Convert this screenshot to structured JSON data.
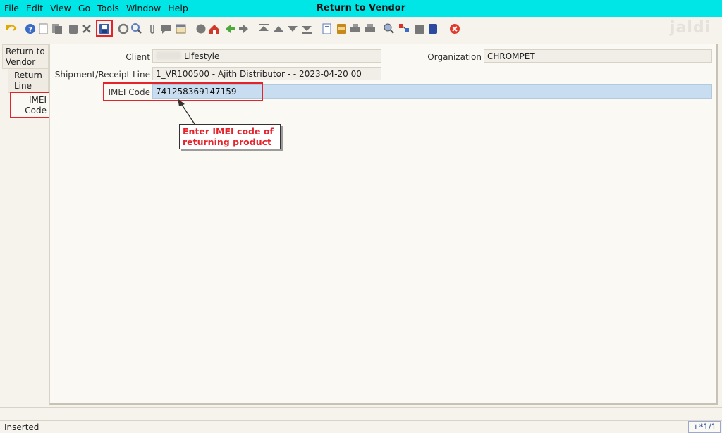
{
  "menu": {
    "items": [
      "File",
      "Edit",
      "View",
      "Go",
      "Tools",
      "Window",
      "Help"
    ]
  },
  "window": {
    "title": "Return to Vendor"
  },
  "watermark": {
    "text": "jaldi"
  },
  "toolbar": {
    "icons": [
      "undo-icon",
      "help-icon",
      "new-icon",
      "copy-icon",
      "delete-icon",
      "delete-selection-icon",
      "save-icon",
      "refresh-icon",
      "find-icon",
      "attachment-icon",
      "chat-icon",
      "grid-toggle-icon",
      "history-icon",
      "home-icon",
      "back-icon",
      "forward-icon",
      "first-record-icon",
      "previous-record-icon",
      "next-record-icon",
      "last-record-icon",
      "report-icon",
      "archive-icon",
      "print-icon",
      "print-preview-icon",
      "zoom-across-icon",
      "request-icon",
      "product-info-icon",
      "workflow-icon",
      "end-icon"
    ]
  },
  "tabs": [
    {
      "label": "Return to Vendor"
    },
    {
      "label": "Return Line"
    },
    {
      "label": "IMEI Code"
    }
  ],
  "form": {
    "client_label": "Client",
    "client_value": "Lifestyle",
    "organization_label": "Organization",
    "organization_value": "CHROMPET",
    "shipment_label": "Shipment/Receipt Line",
    "shipment_value": "1_VR100500 - Ajith Distributor -  - 2023-04-20 00",
    "imei_label": "IMEI Code",
    "imei_value": "741258369147159"
  },
  "annotation": {
    "callout_line1": "Enter IMEI code of",
    "callout_line2": "returning product",
    "color": "#e4232b"
  },
  "status": {
    "text": "Inserted",
    "record": "+*1/1"
  },
  "colors": {
    "titlebar": "#00e5e6",
    "imei_field": "#c8ddf0",
    "highlight": "#e4232b"
  }
}
